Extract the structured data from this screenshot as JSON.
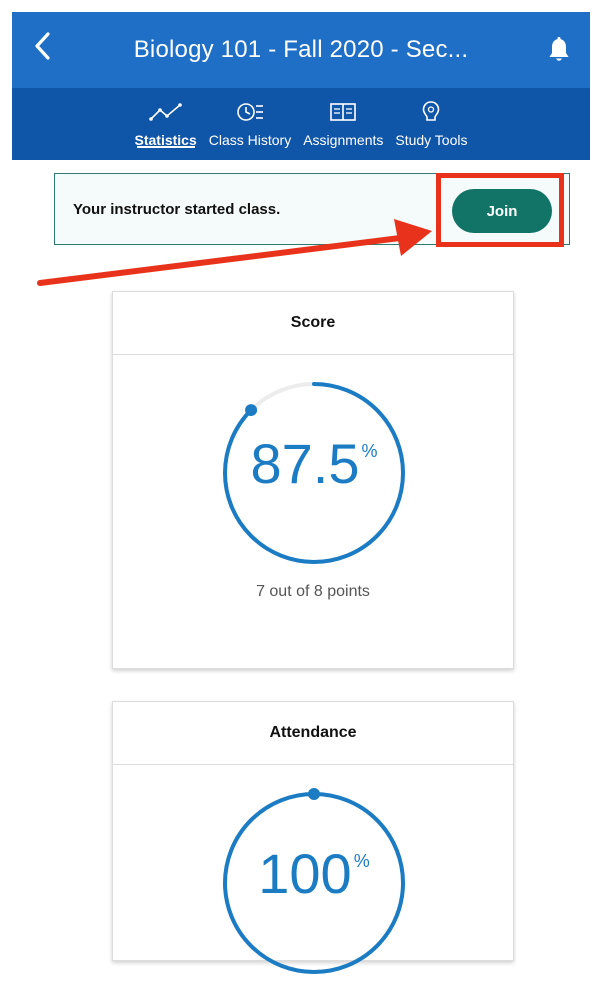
{
  "header": {
    "title": "Biology 101 - Fall 2020 - Sec...",
    "back_icon": "chevron-left-icon",
    "notification_icon": "bell-icon"
  },
  "tabs": [
    {
      "label": "Statistics",
      "icon": "line-chart-icon",
      "active": true
    },
    {
      "label": "Class History",
      "icon": "history-icon",
      "active": false
    },
    {
      "label": "Assignments",
      "icon": "book-icon",
      "active": false
    },
    {
      "label": "Study Tools",
      "icon": "lightbulb-icon",
      "active": false
    }
  ],
  "banner": {
    "message": "Your instructor started class.",
    "join_label": "Join"
  },
  "score_card": {
    "title": "Score",
    "value": "87.5",
    "unit": "%",
    "fraction": 0.875,
    "detail": "7 out of 8 points"
  },
  "attendance_card": {
    "title": "Attendance",
    "value": "100",
    "unit": "%",
    "fraction": 1.0
  },
  "colors": {
    "header": "#1f6fc7",
    "tabs": "#0f55a8",
    "accent": "#1b7cc4",
    "join": "#117466",
    "highlight": "#e8321b"
  }
}
